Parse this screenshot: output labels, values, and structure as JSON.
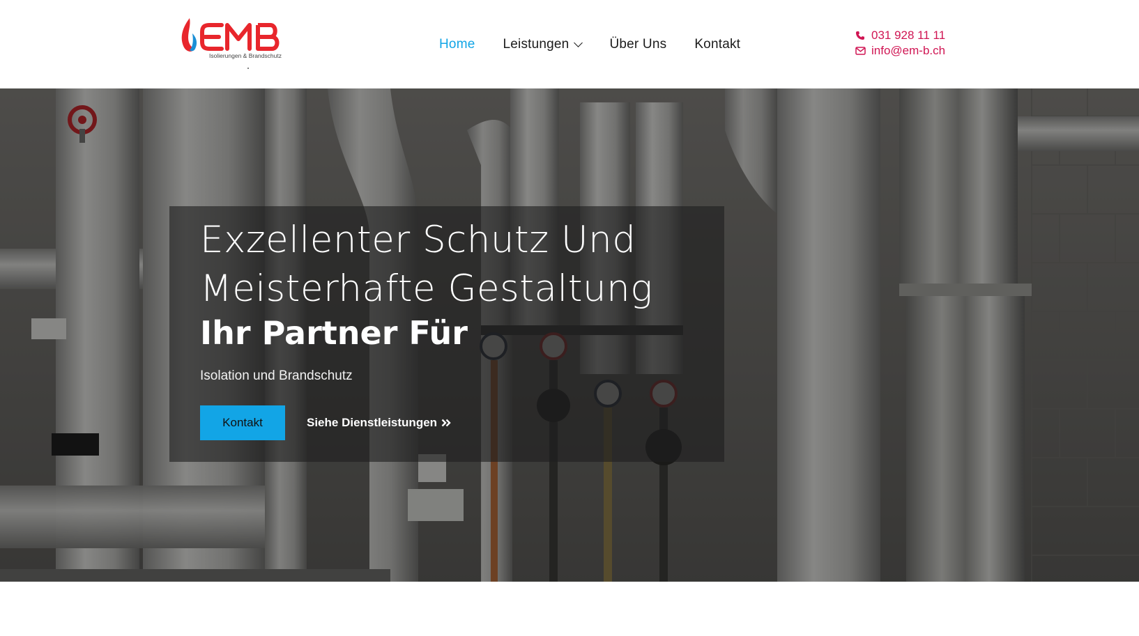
{
  "header": {
    "logo": {
      "brand": "EMB",
      "tagline": "Isolierungen & Brandschutz",
      "icon": "flame-icon"
    },
    "nav": {
      "items": [
        {
          "label": "Home",
          "active": true
        },
        {
          "label": "Leistungen",
          "has_dropdown": true,
          "icon": "chevron-down-icon"
        },
        {
          "label": "Über Uns"
        },
        {
          "label": "Kontakt"
        }
      ]
    },
    "contact": {
      "phone": "031 928 11 11",
      "email": "info@em-b.ch",
      "phone_icon": "phone-icon",
      "email_icon": "envelope-icon"
    }
  },
  "hero": {
    "title_line1": "Exzellenter Schutz Und",
    "title_line2": "Meisterhafte Gestaltung",
    "subtitle": "Ihr Partner Für",
    "text": "Isolation und Brandschutz",
    "primary_button": "Kontakt",
    "secondary_button": "Siehe Dienstleistungen",
    "secondary_icon": "double-chevron-right-icon"
  },
  "colors": {
    "accent_blue": "#12a5e6",
    "accent_red": "#d01553",
    "logo_red": "#e8262c",
    "logo_blue": "#1a8fd6",
    "nav_text": "#1b1b1b"
  }
}
